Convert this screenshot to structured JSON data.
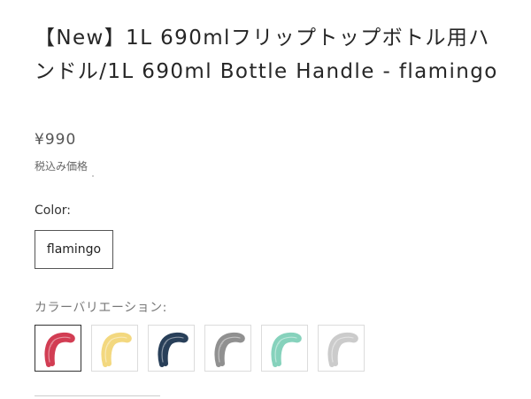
{
  "product": {
    "title": "【New】1L 690mlフリップトップボトル用ハンドル/1L 690ml Bottle Handle - flamingo",
    "price": "¥990",
    "tax_note": "税込み価格"
  },
  "color_option": {
    "label": "Color:",
    "selected_value": "flamingo"
  },
  "variations": {
    "label": "カラーバリエーション:",
    "swatches": [
      {
        "color": "#d0334a",
        "icon": "handle-icon",
        "selected": true
      },
      {
        "color": "#f2d678",
        "icon": "handle-icon",
        "selected": false
      },
      {
        "color": "#1c3550",
        "icon": "handle-icon",
        "selected": false
      },
      {
        "color": "#8a8a8a",
        "icon": "handle-icon",
        "selected": false
      },
      {
        "color": "#7fd0b8",
        "icon": "handle-icon",
        "selected": false
      },
      {
        "color": "#c8c8c8",
        "icon": "handle-icon",
        "selected": false
      }
    ]
  }
}
